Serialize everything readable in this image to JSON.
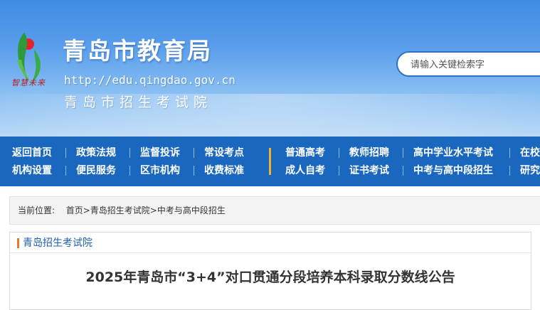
{
  "header": {
    "logo_text": "智慧未来",
    "title": "青岛市教育局",
    "url": "http://edu.qingdao.gov.cn",
    "subtitle": "青岛市招生考试院",
    "search_placeholder": "请输入关键检索字"
  },
  "nav": {
    "row1": [
      "返回首页",
      "政策法规",
      "监督投诉",
      "常设考点",
      "普通高考",
      "教师招聘",
      "高中学业水平考试",
      "在校"
    ],
    "row2": [
      "机构设置",
      "便民服务",
      "区市机构",
      "收费标准",
      "成人自考",
      "证书考试",
      "中考与高中段招生",
      "研究"
    ]
  },
  "breadcrumb": {
    "label": "当前位置:",
    "home": "首页",
    "sep1": ">",
    "section": "青岛招生考试院",
    "sep2": ">",
    "current": "中考与高中段招生"
  },
  "panel": {
    "title": "青岛招生考试院",
    "article_title": "2025年青岛市“3+4”对口贯通分段培养本科录取分数线公告"
  },
  "colors": {
    "nav_bg": "#1a67bf",
    "accent_orange": "#e8772e",
    "nav_divider": "#f0b429",
    "panel_title": "#1d5fae"
  }
}
